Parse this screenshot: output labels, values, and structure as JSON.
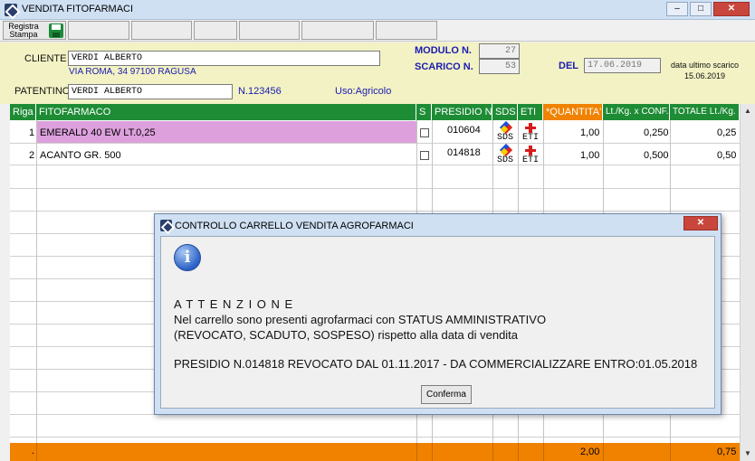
{
  "window": {
    "title": "VENDITA FITOFARMACI",
    "min_glyph": "–",
    "max_glyph": "□",
    "close_glyph": "✕"
  },
  "toolbar": {
    "save_label_line1": "Registra",
    "save_label_line2": "Stampa"
  },
  "customer": {
    "label": "CLIENTE",
    "name": "VERDI ALBERTO",
    "address": "VIA ROMA, 34 97100 RAGUSA",
    "license_label": "PATENTINO",
    "license_holder": "VERDI ALBERTO",
    "license_number": "N.123456",
    "use": "Uso:Agricolo"
  },
  "document": {
    "modulo_label": "MODULO N.",
    "modulo_value": "27",
    "scarico_label": "SCARICO N.",
    "scarico_value": "53",
    "del_label": "DEL",
    "date_value": "17.06.2019",
    "last_discharge_label": "data ultimo scarico",
    "last_discharge_date": "15.06.2019"
  },
  "grid": {
    "columns": [
      "Riga",
      "FITOFARMACO",
      "S",
      "PRESIDIO N.",
      "SDS",
      "ETI",
      "*QUANTITA'",
      "Lt./Kg. x CONF.",
      "TOTALE Lt./Kg."
    ],
    "rows": [
      {
        "riga": "1",
        "product": "EMERALD 40 EW LT.0,25",
        "presidio": "010604",
        "sds": "SDS",
        "eti": "ETI",
        "quantita": "1,00",
        "conf": "0,250",
        "totale": "0,25"
      },
      {
        "riga": "2",
        "product": "ACANTO GR. 500",
        "presidio": "014818",
        "sds": "SDS",
        "eti": "ETI",
        "quantita": "1,00",
        "conf": "0,500",
        "totale": "0,50"
      }
    ],
    "totals": {
      "marker": ".",
      "quantita": "2,00",
      "totale": "0,75"
    },
    "scroll_up": "▲",
    "scroll_down": "▼"
  },
  "dialog": {
    "title": "CONTROLLO CARRELLO VENDITA AGROFARMACI",
    "close": "✕",
    "info_glyph": "i",
    "heading": "A T T E N Z I O N E",
    "line1": "Nel carrello sono presenti agrofarmaci con STATUS AMMINISTRATIVO",
    "line2": "(REVOCATO, SCADUTO, SOSPESO) rispetto alla data di vendita",
    "line3": "PRESIDIO N.014818 REVOCATO DAL 01.11.2017 - DA COMMERCIALIZZARE ENTRO:01.05.2018",
    "button": "Conferma"
  },
  "colors": {
    "header_green": "#1e8c35",
    "quantity_header": "#f08200",
    "row_highlight": "#dda0dd",
    "totals_orange": "#f08200",
    "form_bg": "#f2f2c4"
  }
}
